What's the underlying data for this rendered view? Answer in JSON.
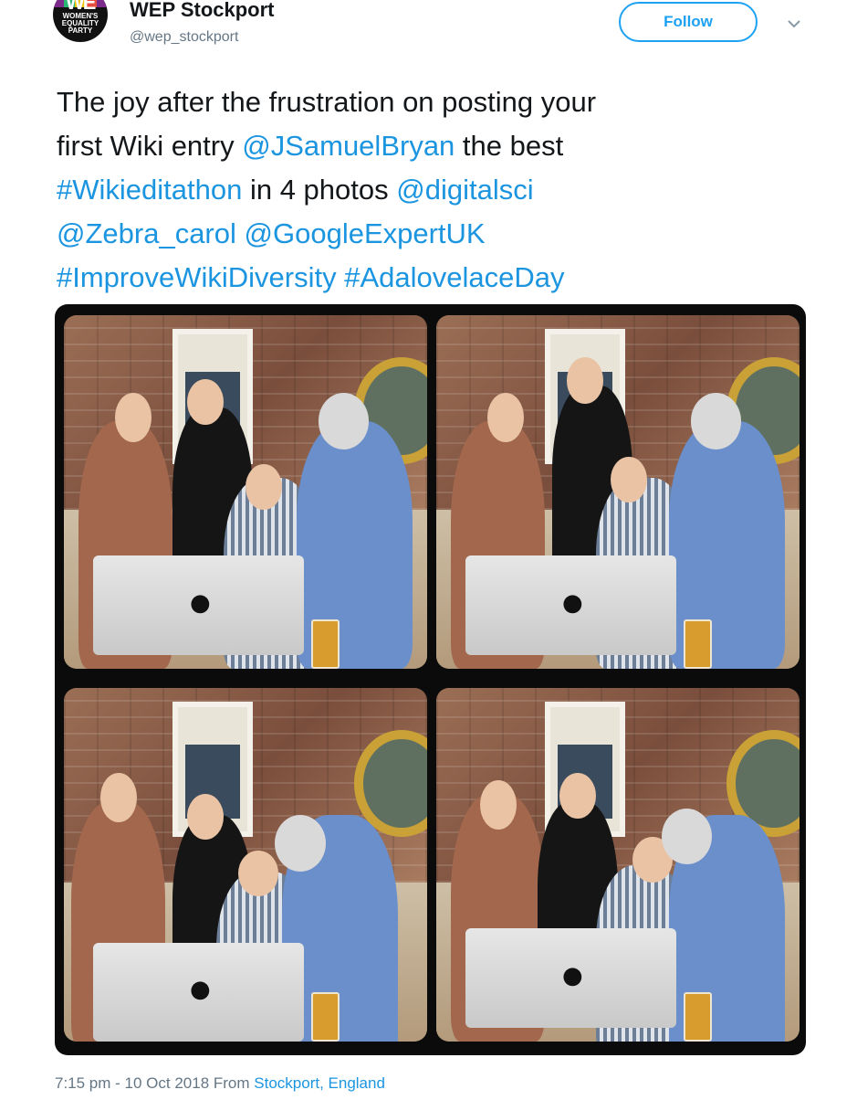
{
  "header": {
    "account_name": "WEP Stockport",
    "handle": "@wep_stockport",
    "follow_label": "Follow",
    "avatar_logo_mark": "WE",
    "avatar_logo_text": "WOMEN'S EQUALITY PARTY"
  },
  "tweet": {
    "lines": [
      [
        "The joy after the frustration on posting your"
      ],
      [
        "first Wiki entry ",
        "@JSamuelBryan",
        " the best"
      ],
      [
        "#Wikieditathon",
        " in 4 photos ",
        "@digitalsci"
      ],
      [
        "@Zebra_carol",
        " ",
        "@GoogleExpertUK"
      ],
      [
        "#ImproveWikiDiversity",
        " ",
        "#AdalovelaceDay"
      ]
    ],
    "t0": "The joy after the frustration on posting your",
    "t1a": "first Wiki entry ",
    "mention1": "@JSamuelBryan",
    "t1b": " the best",
    "hashtag1": "#Wikieditathon",
    "t2": " in 4 photos ",
    "mention2": "@digitalsci",
    "mention3": "@Zebra_carol",
    "mention4": "@GoogleExpertUK",
    "hashtag2": "#ImproveWikiDiversity",
    "hashtag3": "#AdalovelaceDay"
  },
  "footer": {
    "timestamp": "7:15 pm - 10 Oct 2018 From ",
    "location": "Stockport, England"
  },
  "colors": {
    "link": "#1b95e0",
    "follow_border": "#1da1f2",
    "secondary_text": "#657786"
  },
  "icons": {
    "menu": "chevron-down-icon",
    "computer_logo": "apple-logo-icon"
  }
}
